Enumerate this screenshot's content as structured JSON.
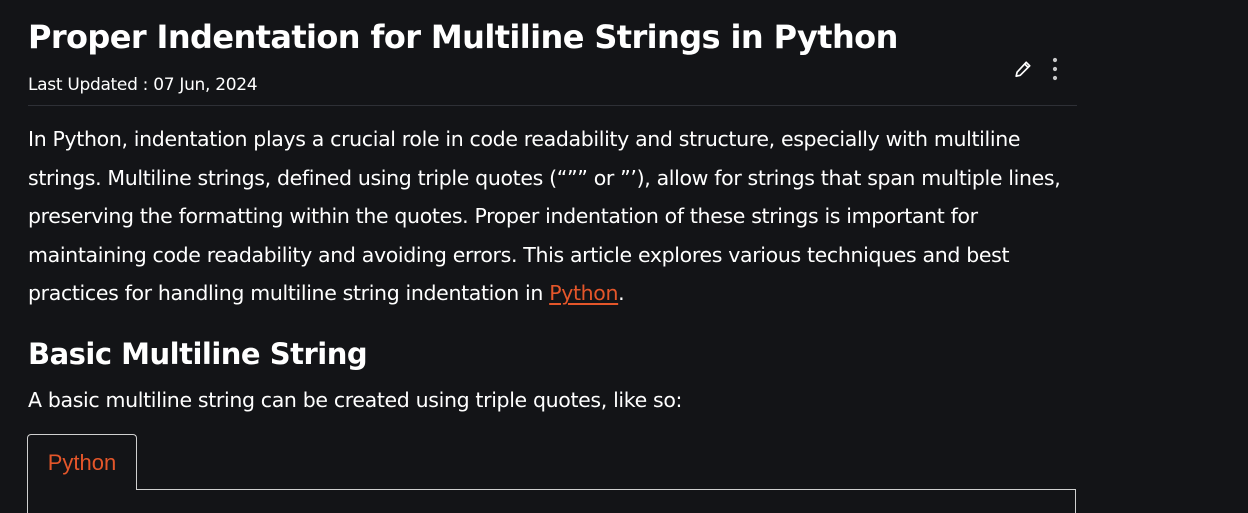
{
  "article": {
    "title": "Proper Indentation for Multiline Strings in Python",
    "last_updated_label": "Last Updated : ",
    "last_updated_date": "07 Jun, 2024"
  },
  "toolbar": {
    "edit_icon": "pencil-icon",
    "more_icon": "vertical-ellipsis-icon"
  },
  "intro": {
    "text": "In Python, indentation plays a crucial role in code readability and structure, especially with multiline strings. Multiline strings, defined using triple quotes (“”” or ”’), allow for strings that span multiple lines, preserving the formatting within the quotes. Proper indentation of these strings is important for maintaining code readability and avoiding errors. This article explores various techniques and best practices for handling multiline string indentation in ",
    "link_text": "Python",
    "end": "."
  },
  "section": {
    "heading": "Basic Multiline String",
    "text": "A basic multiline string can be created using triple quotes, like so:"
  },
  "code_block": {
    "tab_label": "Python"
  },
  "colors": {
    "background": "#131417",
    "text": "#ffffff",
    "accent": "#e4562a",
    "border": "#d0d0d0"
  }
}
